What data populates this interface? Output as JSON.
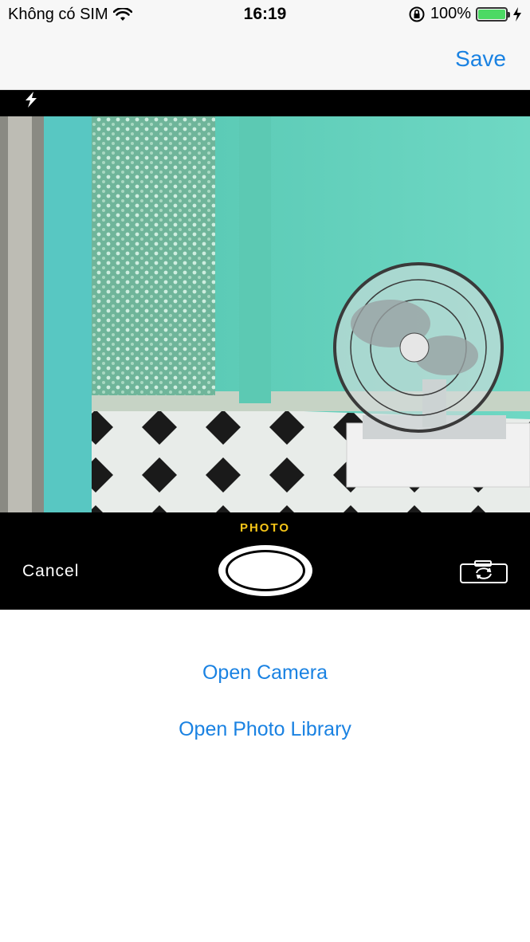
{
  "status_bar": {
    "carrier": "Không có SIM",
    "time": "16:19",
    "battery": "100%",
    "battery_level": 1.0
  },
  "nav": {
    "save_label": "Save"
  },
  "camera": {
    "mode": "PHOTO",
    "cancel_label": "Cancel"
  },
  "actions": {
    "open_camera": "Open Camera",
    "open_library": "Open Photo Library"
  },
  "colors": {
    "accent": "#1a82e2",
    "mode_yellow": "#f5c518",
    "battery_green": "#4cd964"
  },
  "icons": [
    "wifi-icon",
    "rotation-lock-icon",
    "battery-icon",
    "charging-icon",
    "flash-icon",
    "camera-flip-icon"
  ]
}
